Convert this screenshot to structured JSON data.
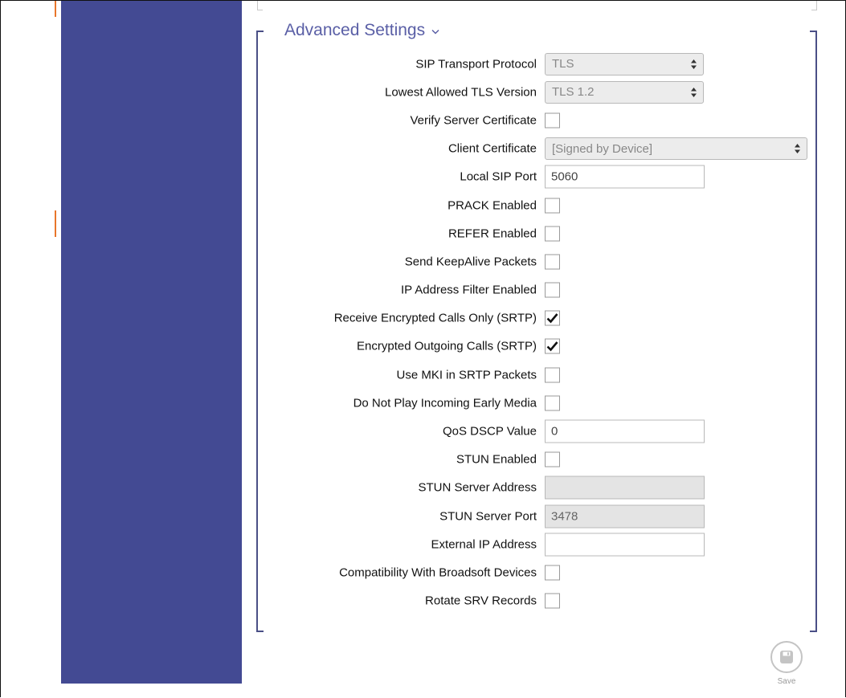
{
  "section": {
    "title": "Advanced Settings",
    "chevron_icon": "chevron-down-icon"
  },
  "fields": {
    "sip_transport_protocol": {
      "label": "SIP Transport Protocol",
      "value": "TLS"
    },
    "lowest_tls_version": {
      "label": "Lowest Allowed TLS Version",
      "value": "TLS 1.2"
    },
    "verify_server_certificate": {
      "label": "Verify Server Certificate",
      "checked": false
    },
    "client_certificate": {
      "label": "Client Certificate",
      "value": "[Signed by Device]"
    },
    "local_sip_port": {
      "label": "Local SIP Port",
      "value": "5060"
    },
    "prack_enabled": {
      "label": "PRACK Enabled",
      "checked": false
    },
    "refer_enabled": {
      "label": "REFER Enabled",
      "checked": false
    },
    "send_keepalive": {
      "label": "Send KeepAlive Packets",
      "checked": false
    },
    "ip_filter_enabled": {
      "label": "IP Address Filter Enabled",
      "checked": false
    },
    "receive_encrypted_only": {
      "label": "Receive Encrypted Calls Only (SRTP)",
      "checked": true
    },
    "encrypted_outgoing": {
      "label": "Encrypted Outgoing Calls (SRTP)",
      "checked": true
    },
    "use_mki": {
      "label": "Use MKI in SRTP Packets",
      "checked": false
    },
    "no_early_media": {
      "label": "Do Not Play Incoming Early Media",
      "checked": false
    },
    "qos_dscp": {
      "label": "QoS DSCP Value",
      "value": "0"
    },
    "stun_enabled": {
      "label": "STUN Enabled",
      "checked": false
    },
    "stun_server_address": {
      "label": "STUN Server Address",
      "value": ""
    },
    "stun_server_port": {
      "label": "STUN Server Port",
      "value": "3478"
    },
    "external_ip": {
      "label": "External IP Address",
      "value": ""
    },
    "broadsoft_compat": {
      "label": "Compatibility With Broadsoft Devices",
      "checked": false
    },
    "rotate_srv": {
      "label": "Rotate SRV Records",
      "checked": false
    }
  },
  "save": {
    "label": "Save",
    "icon": "floppy-disk-icon"
  },
  "colors": {
    "sidebar": "#434a93",
    "accent": "#5a5fa6",
    "bracket": "#4a4f86",
    "marker": "#e8762b"
  }
}
